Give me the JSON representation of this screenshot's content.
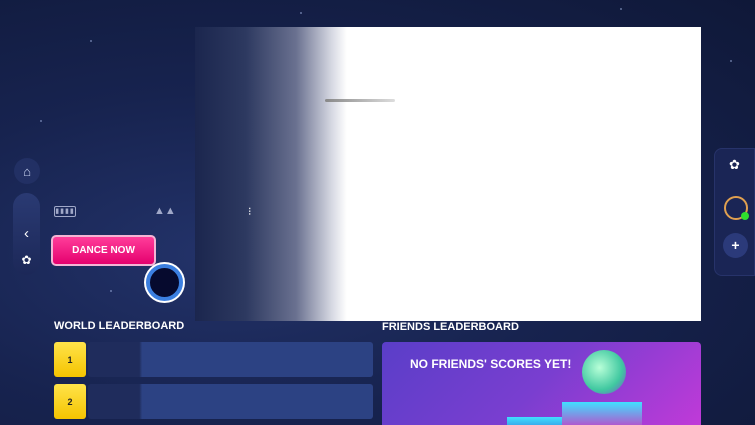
{
  "sidebar": {
    "home_icon": "home-icon",
    "back_icon": "chevron-left-icon",
    "moves_icon": "dance-moves-icon"
  },
  "song_info": {
    "battery_icon": "battery-icon",
    "difficulty_icon": "difficulty-icon",
    "coach_icon": "coach-icon"
  },
  "dance_now_label": "DANCE NOW",
  "right_panel": {
    "moves_icon": "dance-moves-icon",
    "profile_icon": "profile-ring-icon",
    "add_icon": "plus-icon",
    "online_color": "#2ee02e"
  },
  "world_leaderboard": {
    "title": "WORLD LEADERBOARD",
    "rows": [
      {
        "rank": "1"
      },
      {
        "rank": "2"
      }
    ]
  },
  "friends_leaderboard": {
    "title": "FRIENDS LEADERBOARD",
    "message": "NO FRIENDS' SCORES YET!"
  },
  "colors": {
    "accent": "#ff1a84",
    "rank": "#ffd21f"
  }
}
